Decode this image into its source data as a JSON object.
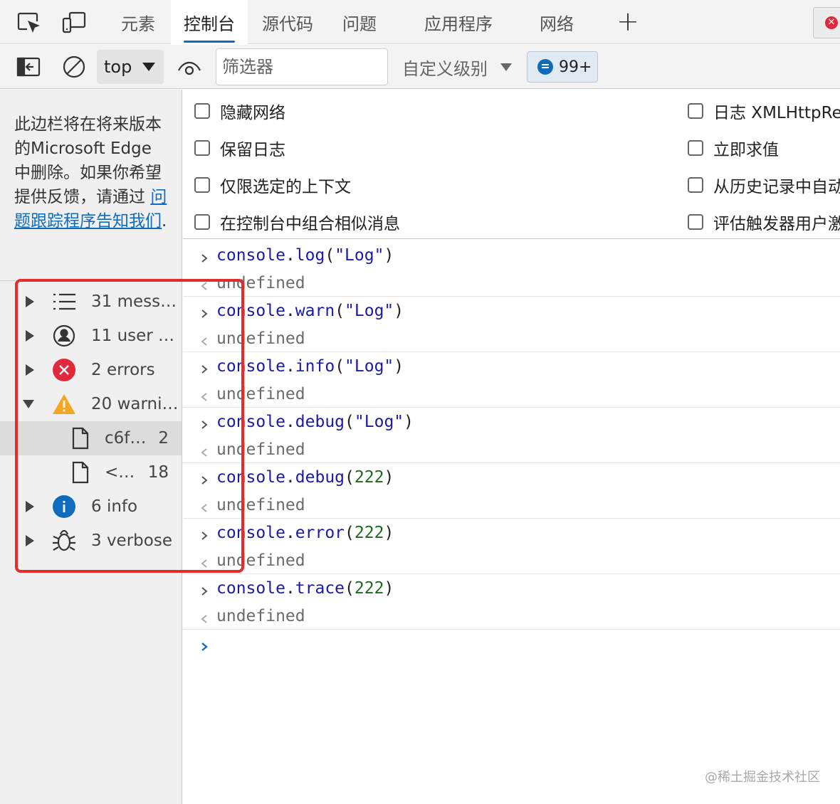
{
  "tabbar": {
    "tabs": [
      {
        "label": "元素"
      },
      {
        "label": "控制台"
      },
      {
        "label": "源代码"
      },
      {
        "label": "问题"
      },
      {
        "label": "应用程序"
      },
      {
        "label": "网络"
      }
    ],
    "add_tab_symbol": "+",
    "error_symbol": "✕"
  },
  "toolbar": {
    "context": "top",
    "filter_placeholder": "筛选器",
    "levels_label": "自定义级别",
    "issues_count": "99+"
  },
  "sidebar": {
    "notice_text": "此边栏将在将来版本的Microsoft Edge 中删除。如果你希望提供反馈，请通过 ",
    "notice_link": "问题跟踪程序告知我们",
    "notice_end": ".",
    "items": [
      {
        "label": "31 mess…"
      },
      {
        "label": "11 user …"
      },
      {
        "label": "2 errors"
      },
      {
        "label": "20 warni…"
      },
      {
        "label": "c6f…",
        "count": "2"
      },
      {
        "label": "<…",
        "count": "18"
      },
      {
        "label": "6 info"
      },
      {
        "label": "3 verbose"
      }
    ]
  },
  "settings": {
    "left": [
      "隐藏网络",
      "保留日志",
      "仅限选定的上下文",
      "在控制台中组合相似消息"
    ],
    "right": [
      "日志 XMLHttpRe",
      "立即求值",
      "从历史记录中自动",
      "评估触发器用户激"
    ]
  },
  "console": {
    "entries": [
      {
        "obj": "console",
        "dot": ".",
        "method": "log",
        "open": "(",
        "arg": "\"Log\"",
        "arg_type": "str",
        "close": ")",
        "result": "undefined"
      },
      {
        "obj": "console",
        "dot": ".",
        "method": "warn",
        "open": "(",
        "arg": "\"Log\"",
        "arg_type": "str",
        "close": ")",
        "result": "undefined"
      },
      {
        "obj": "console",
        "dot": ".",
        "method": "info",
        "open": "(",
        "arg": "\"Log\"",
        "arg_type": "str",
        "close": ")",
        "result": "undefined"
      },
      {
        "obj": "console",
        "dot": ".",
        "method": "debug",
        "open": "(",
        "arg": "\"Log\"",
        "arg_type": "str",
        "close": ")",
        "result": "undefined"
      },
      {
        "obj": "console",
        "dot": ".",
        "method": "debug",
        "open": "(",
        "arg": "222",
        "arg_type": "num",
        "close": ")",
        "result": "undefined"
      },
      {
        "obj": "console",
        "dot": ".",
        "method": "error",
        "open": "(",
        "arg": "222",
        "arg_type": "num",
        "close": ")",
        "result": "undefined"
      },
      {
        "obj": "console",
        "dot": ".",
        "method": "trace",
        "open": "(",
        "arg": "222",
        "arg_type": "num",
        "close": ")",
        "result": "undefined"
      }
    ]
  },
  "watermark": "@稀土掘金技术社区",
  "colors": {
    "accent": "#0f6cbd",
    "error": "#e0293b",
    "warning": "#f5a623",
    "highlight": "#e52b2b"
  }
}
